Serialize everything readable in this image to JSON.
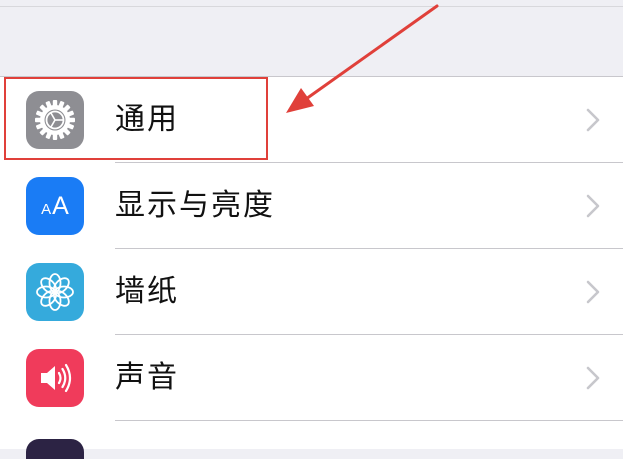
{
  "settings": {
    "items": [
      {
        "label": "通用",
        "icon": "gear-icon",
        "color": "#8e8e93"
      },
      {
        "label": "显示与亮度",
        "icon": "text-size-icon",
        "icon_text": "AA",
        "color": "#1a7cf5"
      },
      {
        "label": "墙纸",
        "icon": "flower-icon",
        "color": "#35aadc"
      },
      {
        "label": "声音",
        "icon": "speaker-icon",
        "color": "#f03b5b"
      }
    ]
  },
  "annotation": {
    "color": "#e0403a"
  }
}
